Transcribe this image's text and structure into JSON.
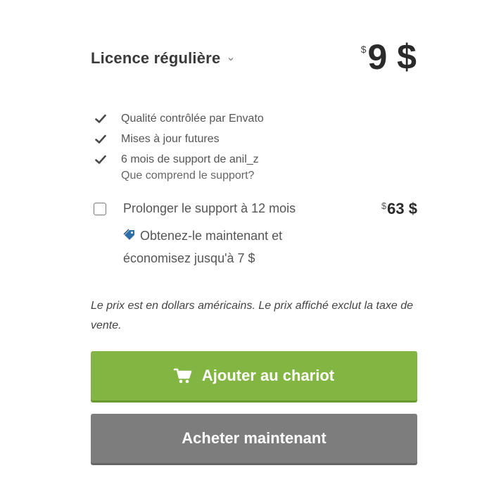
{
  "license": {
    "name": "Licence régulière",
    "price_symbol": "$",
    "price_value": "9 $"
  },
  "features": [
    {
      "label": "Qualité contrôlée par Envato",
      "icon": "check-icon"
    },
    {
      "label": "Mises à jour futures",
      "icon": "check-icon"
    },
    {
      "label": "6 mois de support de anil_z",
      "icon": "check-icon"
    }
  ],
  "support_link": "Que comprend le support?",
  "extend": {
    "label": "Prolonger le support à 12 mois",
    "price_symbol": "$",
    "price_value": "63 $",
    "promo_text": "Obtenez-le maintenant et économisez jusqu'à 7 $",
    "promo_icon": "tag-icon"
  },
  "note": "Le prix est en dollars américains. Le prix affiché exclut la taxe de vente.",
  "buttons": {
    "add_to_cart": "Ajouter au chariot",
    "buy_now": "Acheter maintenant"
  },
  "colors": {
    "cart_button": "#82b541",
    "buy_button": "#7d7d7d",
    "promo_icon": "#2f6fa8"
  }
}
